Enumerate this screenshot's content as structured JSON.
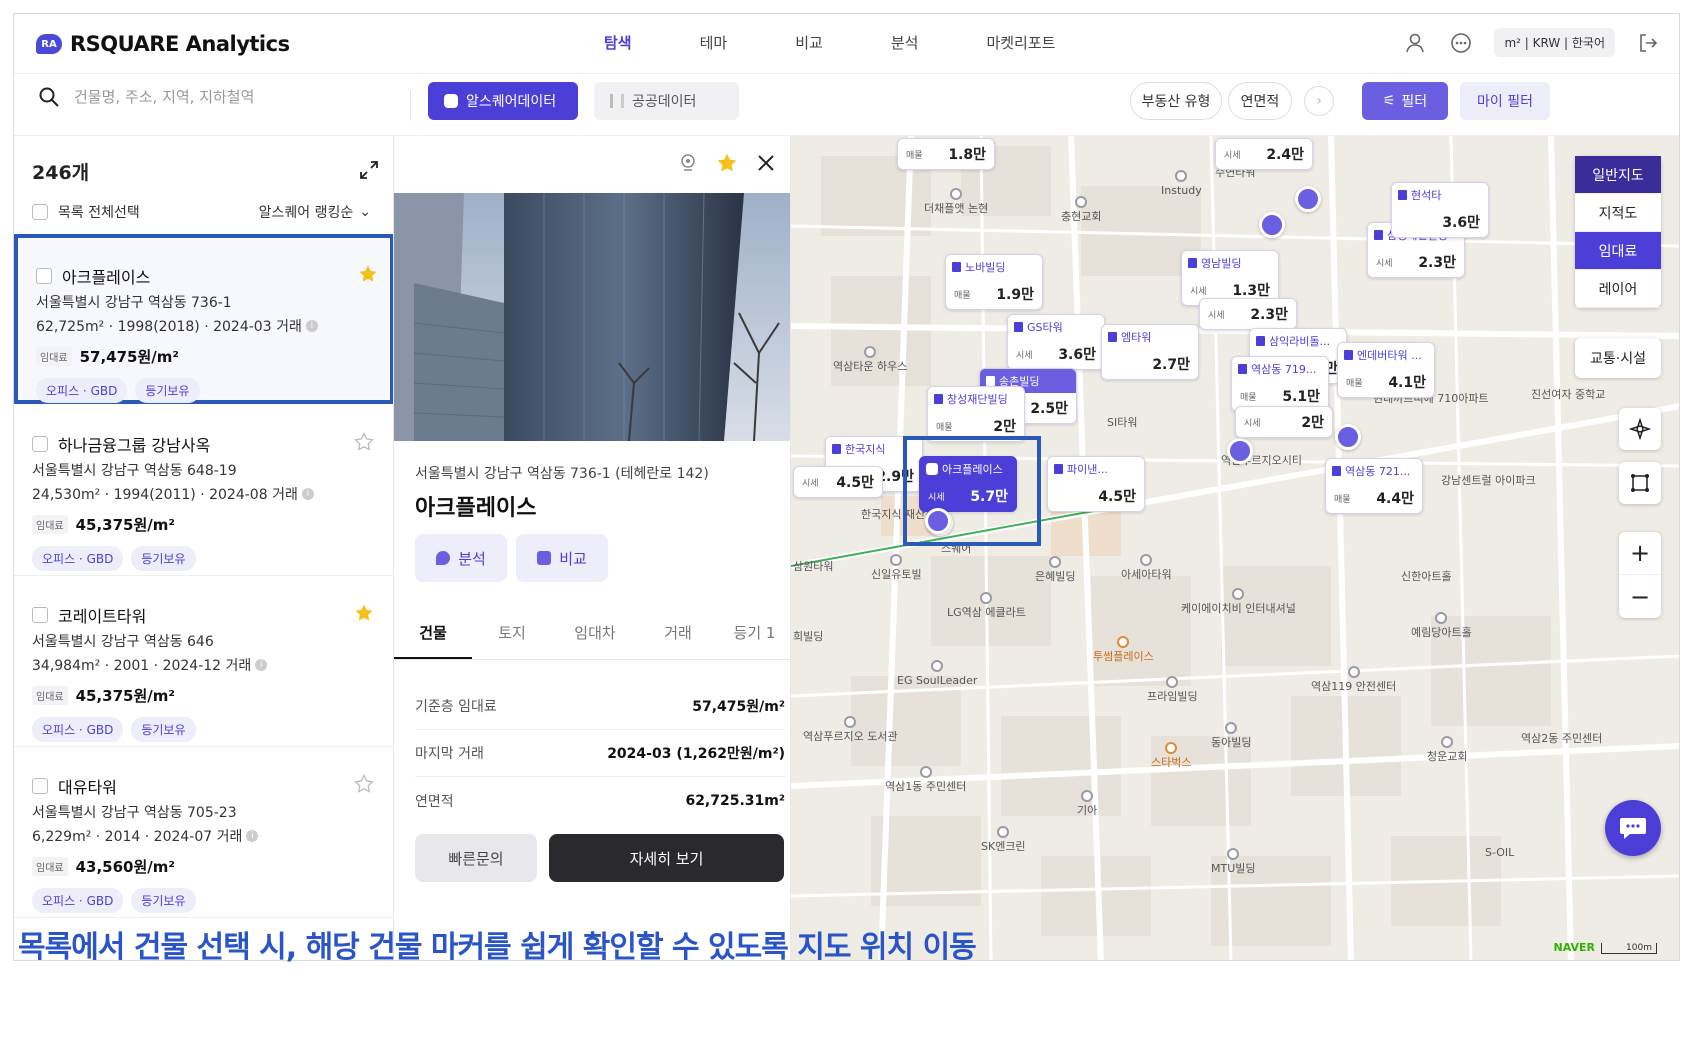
{
  "header": {
    "logo_mark": "RA",
    "brand": "RSQUARE Analytics",
    "nav": [
      "탐색",
      "테마",
      "비교",
      "분석",
      "마켓리포트"
    ],
    "active_nav": 0,
    "unit_selector": "m² | KRW | 한국어"
  },
  "toolbar": {
    "search_placeholder": "건물명, 주소, 지역, 지하철역",
    "source_rsquare": "알스퀘어데이터",
    "source_public": "공공데이터",
    "chip_type": "부동산 유형",
    "chip_area": "연면적",
    "filter_label": "필터",
    "my_filter_label": "마이 필터"
  },
  "list": {
    "count": "246개",
    "select_all": "목록 전체선택",
    "sort": "알스퀘어 랭킹순",
    "rent_tag": "임대료",
    "items": [
      {
        "name": "아크플레이스",
        "addr": "서울특별시 강남구 역삼동 736-1",
        "meta": "62,725m² · 1998(2018) · 2024-03 거래",
        "rent": "57,475원/m²",
        "tags": [
          "오피스 · GBD",
          "등기보유"
        ],
        "starred": true
      },
      {
        "name": "하나금융그룹 강남사옥",
        "addr": "서울특별시 강남구 역삼동 648-19",
        "meta": "24,530m² · 1994(2011) · 2024-08 거래",
        "rent": "45,375원/m²",
        "tags": [
          "오피스 · GBD",
          "등기보유"
        ],
        "starred": false
      },
      {
        "name": "코레이트타워",
        "addr": "서울특별시 강남구 역삼동 646",
        "meta": "34,984m² · 2001 · 2024-12 거래",
        "rent": "45,375원/m²",
        "tags": [
          "오피스 · GBD",
          "등기보유"
        ],
        "starred": true
      },
      {
        "name": "대유타워",
        "addr": "서울특별시 강남구 역삼동 705-23",
        "meta": "6,229m² · 2014 · 2024-07 거래",
        "rent": "43,560원/m²",
        "tags": [
          "오피스 · GBD",
          "등기보유"
        ],
        "starred": false
      }
    ]
  },
  "detail": {
    "address": "서울특별시 강남구 역삼동 736-1 (테헤란로 142)",
    "name": "아크플레이스",
    "btn_analysis": "분석",
    "btn_compare": "비교",
    "tabs": [
      "건물",
      "토지",
      "임대차",
      "거래",
      "등기 1"
    ],
    "rows": [
      {
        "k": "기준층 임대료",
        "v": "57,475원/m²"
      },
      {
        "k": "마지막 거래",
        "v": "2024-03 (1,262만원/m²)"
      },
      {
        "k": "연면적",
        "v": "62,725.31m²"
      }
    ],
    "cta_inquiry": "빠른문의",
    "cta_more": "자세히 보기"
  },
  "map": {
    "map_types": [
      "일반지도",
      "지적도",
      "임대료"
    ],
    "layer": "레이어",
    "transit": "교통·시설",
    "naver": "NAVER",
    "scale": "100m",
    "markers": [
      {
        "name": "노바빌딩",
        "label": "매물",
        "price": "1.9만",
        "active": false
      },
      {
        "name": "GS타워",
        "label": "시세",
        "price": "3.6만",
        "active": false
      },
      {
        "name": "영남빌딩",
        "label": "시세",
        "price": "1.3만",
        "active": false
      },
      {
        "name": "엠타워",
        "label": "",
        "price": "2.7만",
        "active": false
      },
      {
        "name": "송촌빌딩",
        "label": "",
        "price": "2.5만",
        "active": false
      },
      {
        "name": "창성재단빌딩",
        "label": "매물",
        "price": "2만",
        "active": false
      },
      {
        "name": "한국지식",
        "label": "시세",
        "price": "2.9만",
        "active": false
      },
      {
        "name": "아크플레이스",
        "label": "시세",
        "price": "5.7만",
        "active": true
      },
      {
        "name": "파이낸...",
        "label": "",
        "price": "4.5만",
        "active": false
      },
      {
        "name": "삼익라비돌...",
        "label": "",
        "price": "3.3만",
        "active": false
      },
      {
        "name": "역삼동 719...",
        "label": "매물",
        "price": "5.1만",
        "active": false
      },
      {
        "name": "엔데버타워 ...",
        "label": "매물",
        "price": "4.1만",
        "active": false
      },
      {
        "name": "역삼동 721...",
        "label": "매물",
        "price": "4.4만",
        "active": false
      },
      {
        "name": "삼성제일빌딩",
        "label": "시세",
        "price": "2.3만",
        "active": false
      },
      {
        "name": "현석타",
        "label": "",
        "price": "3.6만",
        "active": false
      },
      {
        "name": "",
        "label": "매물",
        "price": "1.8만",
        "active": false
      },
      {
        "name": "",
        "label": "시세",
        "price": "2.4만",
        "active": false
      },
      {
        "name": "",
        "label": "시세",
        "price": "2.3만",
        "active": false
      },
      {
        "name": "",
        "label": "시세",
        "price": "2만",
        "active": false
      },
      {
        "name": "",
        "label": "시세",
        "price": "4.5만",
        "active": false
      }
    ],
    "pois": [
      "수연타워",
      "더채플앳 논현",
      "충현교회",
      "Instudy",
      "역삼타운 하우스",
      "SI타워",
      "한국지식 재산센터",
      "스퀘어",
      "신일유토빌",
      "LG역삼 에클라트",
      "EG SoulLeader",
      "역삼푸르지오 도서관",
      "역삼1동 주민센터",
      "은혜빌딩",
      "아세아타워",
      "케이에이치비 인터내셔널",
      "투썸플레이스",
      "프라임빌딩",
      "동아빌딩",
      "스타벅스",
      "역삼119 안전센터",
      "신한아트홀",
      "예림당아트홀",
      "청운교회",
      "역삼2동 주민센터",
      "현대까르띠에 710아파트",
      "강남센트럴 아이파크",
      "진선여자 중학교",
      "기아",
      "SK엔크린",
      "MTU빌딩",
      "S-OIL",
      "삼원타워",
      "희빌딩",
      "역삼푸르지오시티"
    ]
  },
  "caption": "목록에서 건물 선택 시, 해당 건물 마커를 쉽게 확인할 수 있도록 지도 위치 이동",
  "colors": {
    "accent": "#4b3fd8",
    "highlight": "#2a59b6",
    "caption": "#2a55c8"
  }
}
